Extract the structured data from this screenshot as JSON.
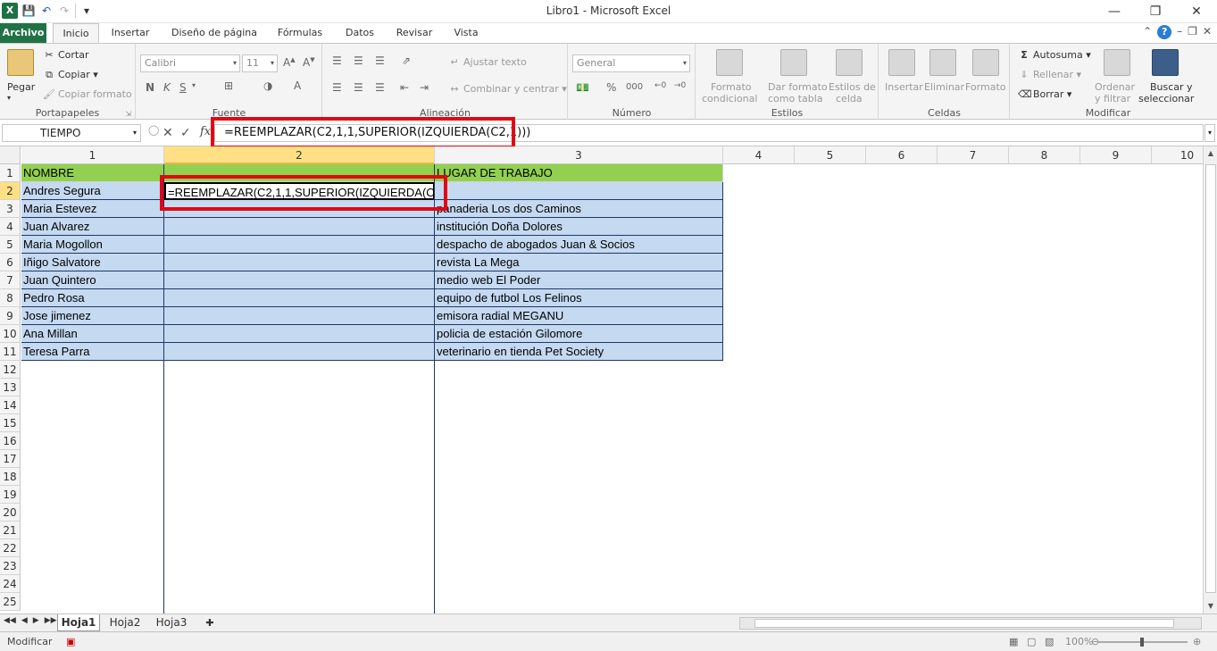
{
  "app": {
    "title": "Libro1  -  Microsoft Excel",
    "logo": "X"
  },
  "tabs": [
    {
      "label": "Archivo"
    },
    {
      "label": "Inicio"
    },
    {
      "label": "Insertar"
    },
    {
      "label": "Diseño de página"
    },
    {
      "label": "Fórmulas"
    },
    {
      "label": "Datos"
    },
    {
      "label": "Revisar"
    },
    {
      "label": "Vista"
    }
  ],
  "ribbon": {
    "portapapeles": {
      "label": "Portapapeles",
      "pegar": "Pegar",
      "cortar": "Cortar",
      "copiar": "Copiar",
      "copiar_formato": "Copiar formato"
    },
    "fuente": {
      "label": "Fuente",
      "font_name": "Calibri",
      "font_size": "11",
      "bold": "N",
      "italic": "K",
      "underline": "S"
    },
    "alineacion": {
      "label": "Alineación",
      "ajustar_texto": "Ajustar texto",
      "combinar": "Combinar y centrar"
    },
    "numero": {
      "label": "Número",
      "format": "General",
      "percent": "%",
      "thousands": "000"
    },
    "estilos": {
      "label": "Estilos",
      "formato_condicional_1": "Formato",
      "formato_condicional_2": "condicional",
      "dar_formato_1": "Dar formato",
      "dar_formato_2": "como tabla",
      "estilos_celda_1": "Estilos de",
      "estilos_celda_2": "celda"
    },
    "celdas": {
      "label": "Celdas",
      "insertar": "Insertar",
      "eliminar": "Eliminar",
      "formato": "Formato"
    },
    "modificar": {
      "label": "Modificar",
      "autosuma": "Autosuma",
      "rellenar": "Rellenar",
      "borrar": "Borrar",
      "ordenar_1": "Ordenar",
      "ordenar_2": "y filtrar",
      "buscar_1": "Buscar y",
      "buscar_2": "seleccionar"
    }
  },
  "formula_bar": {
    "name_box": "TIEMPO",
    "fx": "fx",
    "formula": "=REEMPLAZAR(C2,1,1,SUPERIOR(IZQUIERDA(C2,1)))"
  },
  "sheet": {
    "columns": [
      "1",
      "2",
      "3",
      "4",
      "5",
      "6",
      "7",
      "8",
      "9",
      "10"
    ],
    "rows": [
      "1",
      "2",
      "3",
      "4",
      "5",
      "6",
      "7",
      "8",
      "9",
      "10",
      "11",
      "12",
      "13",
      "14",
      "15",
      "16",
      "17",
      "18",
      "19",
      "20",
      "21",
      "22",
      "23",
      "24",
      "25"
    ],
    "header_row": {
      "col1": "NOMBRE",
      "col3": "LUGAR DE TRABAJO"
    },
    "active_cell_formula": "=REEMPLAZAR(C2,1,1,SUPERIOR(IZQUIERDA(C2,1)))",
    "data": [
      {
        "name": "Andres Segura",
        "work": ""
      },
      {
        "name": "Maria Estevez",
        "work": "panaderia Los dos Caminos"
      },
      {
        "name": "Juan Alvarez",
        "work": "institución Doña Dolores"
      },
      {
        "name": "Maria Mogollon",
        "work": "despacho de abogados Juan & Socios"
      },
      {
        "name": "Iñigo Salvatore",
        "work": "revista La Mega"
      },
      {
        "name": "Juan Quintero",
        "work": "medio web El Poder"
      },
      {
        "name": "Pedro Rosa",
        "work": "equipo de futbol Los Felinos"
      },
      {
        "name": "Jose jimenez",
        "work": "emisora radial MEGANU"
      },
      {
        "name": "Ana Millan",
        "work": "policia de estación Gilomore"
      },
      {
        "name": "Teresa Parra",
        "work": "veterinario en tienda Pet Society"
      }
    ]
  },
  "sheet_tabs": [
    "Hoja1",
    "Hoja2",
    "Hoja3"
  ],
  "status": {
    "mode": "Modificar",
    "zoom": "100%"
  },
  "colors": {
    "excel_green": "#207245",
    "header_fill": "#92d050",
    "data_fill": "#c5d9f1",
    "highlight_red": "#e30613",
    "selected_header": "#ffe084"
  }
}
